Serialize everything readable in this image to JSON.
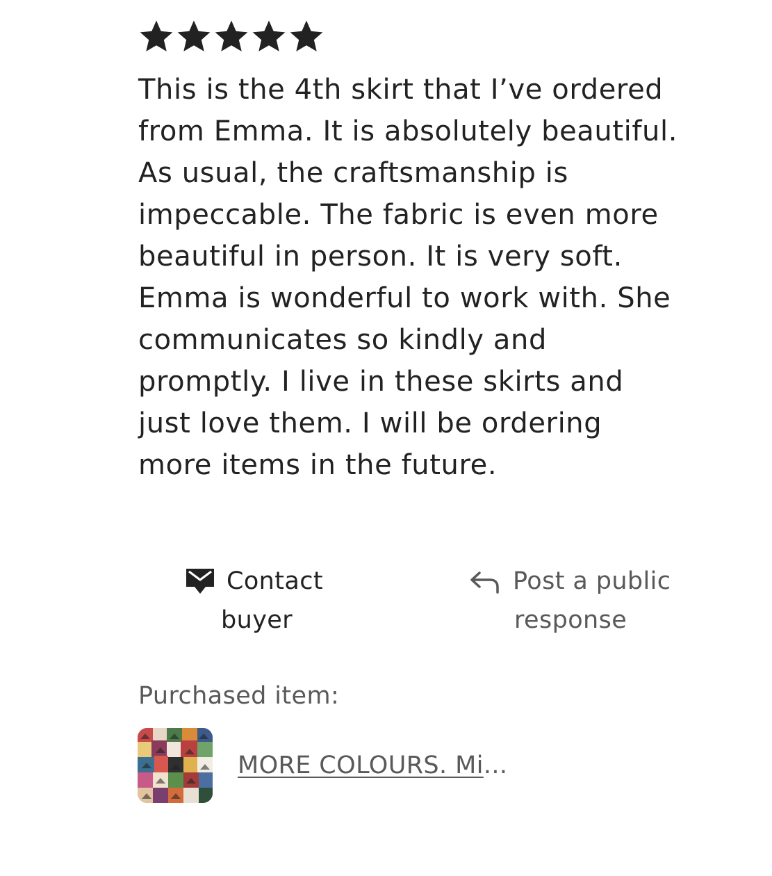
{
  "review": {
    "rating": 5,
    "star_icons": [
      "star-icon",
      "star-icon",
      "star-icon",
      "star-icon",
      "star-icon"
    ],
    "text_lines": [
      "This is the 4th skirt that I’ve ordered",
      "from Emma. It is absolutely beautiful.",
      "As usual, the craftsmanship is",
      "impeccable. The fabric is even more",
      "beautiful in person. It is very soft.",
      "Emma is wonderful to work with. She",
      "communicates so kindly and",
      "promptly. I live in these skirts and",
      "just love them. I will be ordering",
      "more items in the future."
    ]
  },
  "actions": {
    "contact": {
      "icon": "message-icon",
      "label_line1": "Contact",
      "label_line2": "buyer"
    },
    "post_response": {
      "icon": "reply-arrow-icon",
      "label_line1": "Post a public",
      "label_line2": "response"
    }
  },
  "purchased": {
    "label": "Purchased item:",
    "thumbnail_icon": "product-thumbnail",
    "item_title_underlined": "MORE COLOURS. Mi",
    "item_title_ellipsis": "..."
  },
  "colors": {
    "text_primary": "#222222",
    "text_secondary": "#595959",
    "background": "#ffffff"
  }
}
